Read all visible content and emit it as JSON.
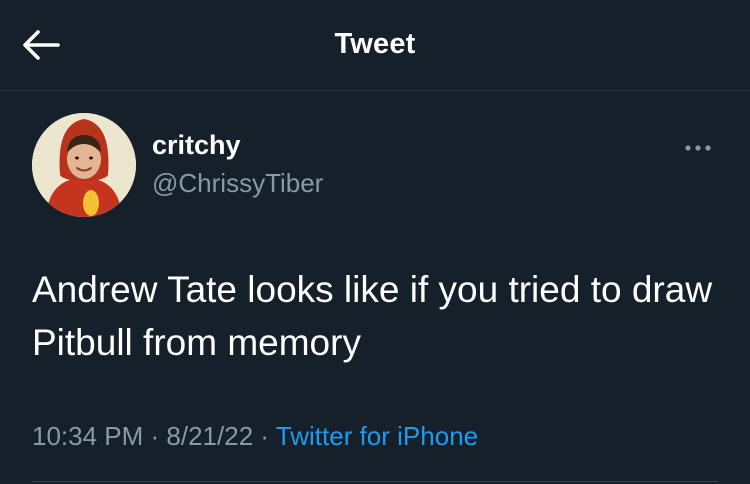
{
  "header": {
    "title": "Tweet",
    "back_icon": "arrow-left-icon"
  },
  "author": {
    "display_name": "critchy",
    "handle": "@ChrissyTiber",
    "avatar_icon": "avatar-hotdog-costume"
  },
  "more_icon": "more-horizontal-icon",
  "tweet": {
    "text": "Andrew Tate looks like if you tried to draw Pitbull from memory",
    "time": "10:34 PM",
    "sep1": " · ",
    "date": "8/21/22",
    "sep2": " · ",
    "source": "Twitter for iPhone"
  },
  "colors": {
    "background": "#15202b",
    "text": "#ffffff",
    "muted": "#8b98a5",
    "link": "#1d9bf0"
  }
}
